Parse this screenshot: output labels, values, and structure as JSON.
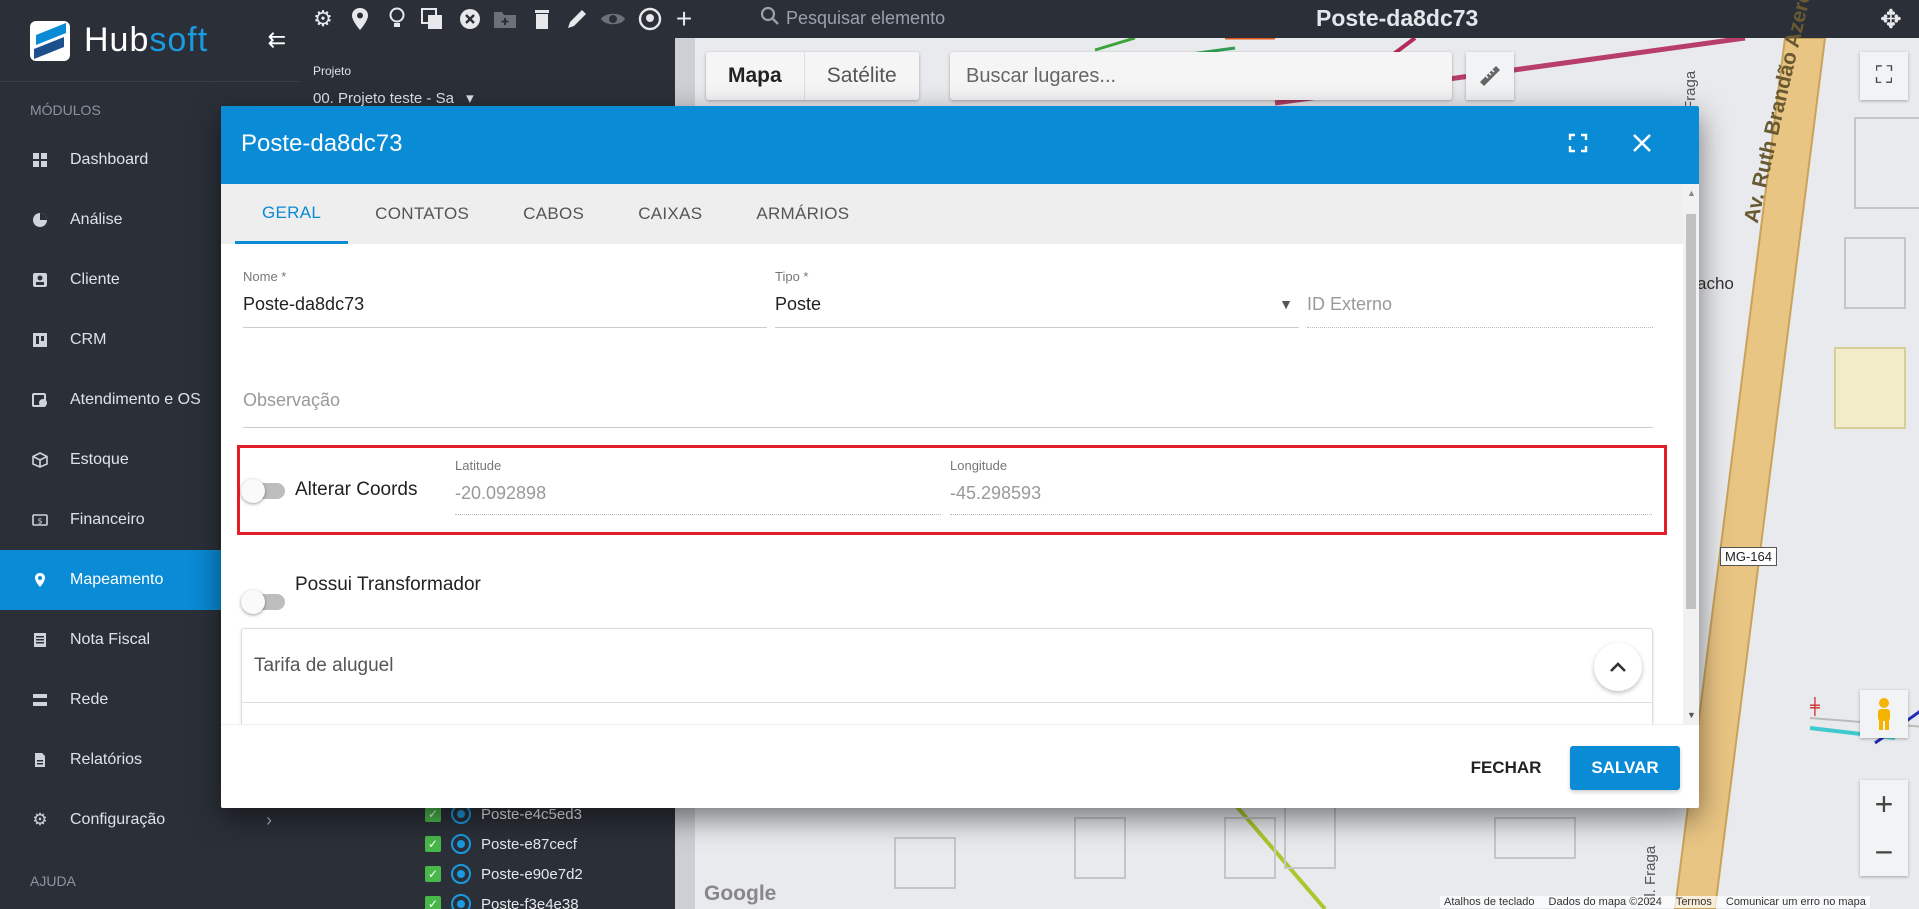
{
  "app": {
    "brand_a": "Hub",
    "brand_b": "soft",
    "collapse_icon": "collapse-menu-icon"
  },
  "colors": {
    "primary": "#0a8bd6",
    "sidebar_bg": "#2b3038",
    "highlight": "#e41e26",
    "check": "#49b84a"
  },
  "sidebar": {
    "section_modules": "MÓDULOS",
    "section_help": "AJUDA",
    "items": [
      {
        "label": "Dashboard",
        "icon": "dashboard-icon"
      },
      {
        "label": "Análise",
        "icon": "pie-chart-icon"
      },
      {
        "label": "Cliente",
        "icon": "client-card-icon"
      },
      {
        "label": "CRM",
        "icon": "crm-board-icon"
      },
      {
        "label": "Atendimento e OS",
        "icon": "calendar-clock-icon"
      },
      {
        "label": "Estoque",
        "icon": "box-icon"
      },
      {
        "label": "Financeiro",
        "icon": "money-icon"
      },
      {
        "label": "Mapeamento",
        "icon": "map-pin-icon",
        "active": true
      },
      {
        "label": "Nota Fiscal",
        "icon": "invoice-icon"
      },
      {
        "label": "Rede",
        "icon": "network-icon"
      },
      {
        "label": "Relatórios",
        "icon": "report-icon"
      },
      {
        "label": "Configuração",
        "icon": "gear-icon"
      }
    ]
  },
  "toolbar": {
    "search_placeholder": "Pesquisar elemento",
    "title": "Poste-da8dc73"
  },
  "project": {
    "label": "Projeto",
    "value": "00. Projeto teste - Sa"
  },
  "tree": [
    "Poste-e4c5ed3",
    "Poste-e87cecf",
    "Poste-e90e7d2",
    "Poste-f3e4e38"
  ],
  "map": {
    "type_map": "Mapa",
    "type_satellite": "Satélite",
    "search_placeholder": "Buscar lugares...",
    "road_label": "Av. Ruth Brandão Azeredo",
    "street_label": "Fraga",
    "street_label_2": "el. Fraga",
    "place_label": "acho",
    "highway_badge": "MG-164",
    "google": "Google",
    "attribution": [
      "Atalhos de teclado",
      "Dados do mapa ©2024",
      "Termos",
      "Comunicar um erro no mapa"
    ]
  },
  "dialog": {
    "title": "Poste-da8dc73",
    "tabs": [
      "GERAL",
      "CONTATOS",
      "CABOS",
      "CAIXAS",
      "ARMÁRIOS"
    ],
    "nome_label": "Nome *",
    "nome_value": "Poste-da8dc73",
    "tipo_label": "Tipo *",
    "tipo_value": "Poste",
    "id_externo_placeholder": "ID Externo",
    "observacao_placeholder": "Observação",
    "alterar_coords_label": "Alterar Coords",
    "latitude_label": "Latitude",
    "latitude_value": "-20.092898",
    "longitude_label": "Longitude",
    "longitude_value": "-45.298593",
    "transformador_label": "Possui Transformador",
    "tarifa_label": "Tarifa de aluguel",
    "btn_close": "FECHAR",
    "btn_save": "SALVAR"
  }
}
